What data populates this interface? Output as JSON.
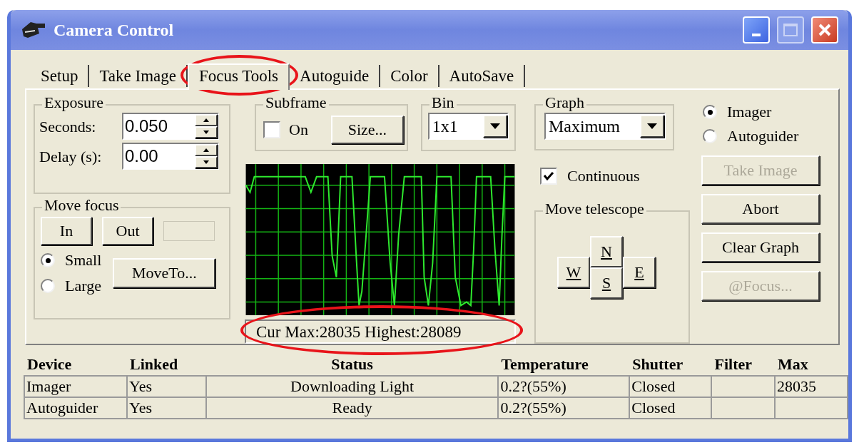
{
  "window": {
    "title": "Camera Control"
  },
  "tabs": [
    {
      "label": "Setup",
      "selected": false,
      "circled": false
    },
    {
      "label": "Take Image",
      "selected": false,
      "circled": false
    },
    {
      "label": "Focus Tools",
      "selected": true,
      "circled": true
    },
    {
      "label": "Autoguide",
      "selected": false,
      "circled": false
    },
    {
      "label": "Color",
      "selected": false,
      "circled": false
    },
    {
      "label": "AutoSave",
      "selected": false,
      "circled": false
    }
  ],
  "exposure": {
    "title": "Exposure",
    "fields": [
      {
        "label": "Seconds:",
        "value": "0.050"
      },
      {
        "label": "Delay (s):",
        "value": "0.00"
      }
    ]
  },
  "move_focus": {
    "title": "Move focus",
    "buttons": [
      "In",
      "Out"
    ],
    "radios": [
      {
        "label": "Small",
        "selected": true
      },
      {
        "label": "Large",
        "selected": false
      }
    ],
    "move_to": "MoveTo..."
  },
  "subframe": {
    "title": "Subframe",
    "checkbox": {
      "label": "On",
      "checked": false
    },
    "button": "Size..."
  },
  "bin": {
    "title": "Bin",
    "value": "1x1"
  },
  "graph": {
    "title": "Graph",
    "value": "Maximum"
  },
  "readout": {
    "text": "Cur Max:28035 Highest:28089",
    "circled": true
  },
  "continuous": {
    "label": "Continuous",
    "checked": true
  },
  "move_telescope": {
    "title": "Move telescope",
    "north": "N",
    "south": "S",
    "west": "W",
    "east": "E"
  },
  "camera_select": [
    {
      "label": "Imager",
      "selected": true
    },
    {
      "label": "Autoguider",
      "selected": false
    }
  ],
  "actions": [
    {
      "label": "Take Image",
      "disabled": true
    },
    {
      "label": "Abort",
      "disabled": false
    },
    {
      "label": "Clear Graph",
      "disabled": false
    },
    {
      "label": "@Focus...",
      "disabled": true
    }
  ],
  "table": {
    "columns": [
      "Device",
      "Linked",
      "Status",
      "Temperature",
      "Shutter",
      "Filter",
      "Max"
    ],
    "rows": [
      [
        "Imager",
        "Yes",
        "Downloading Light",
        "0.2?(55%)",
        "Closed",
        "",
        "28035"
      ],
      [
        "Autoguider",
        "Yes",
        "Ready",
        "0.2?(55%)",
        "Closed",
        "",
        ""
      ]
    ]
  }
}
